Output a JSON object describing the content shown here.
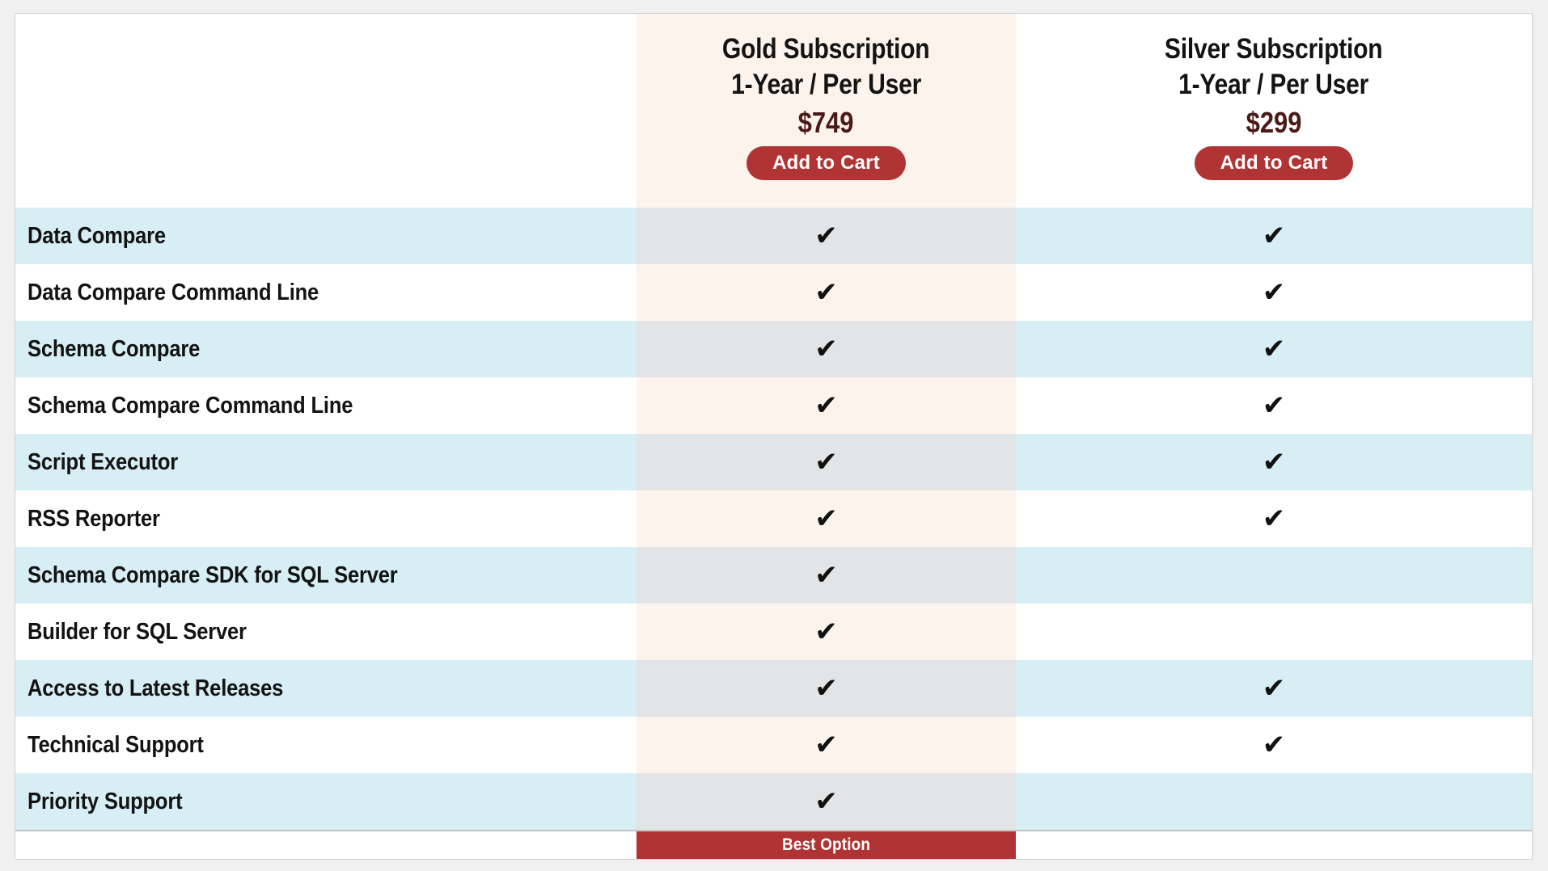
{
  "table": {
    "plans": [
      {
        "id": "gold",
        "name": "Gold Subscription",
        "term": "1-Year / Per User",
        "price": "$749",
        "cta_label": "Add to Cart",
        "badge": "Best Option",
        "accent_color": "#b03434",
        "price_color": "#4a1a16",
        "column_tint_odd": "#e3e4e5",
        "column_tint_even": "#fdf3ed"
      },
      {
        "id": "silver",
        "name": "Silver Subscription",
        "term": "1-Year / Per User",
        "price": "$299",
        "cta_label": "Add to Cart",
        "badge": "",
        "accent_color": "#b03434",
        "price_color": "#4a1a16",
        "column_tint_odd": "#d6eef4",
        "column_tint_even": "#ffffff"
      }
    ],
    "check_glyph": "✔",
    "stripe_color": "#d6eef4",
    "features": [
      {
        "label": "Data Compare",
        "gold": true,
        "silver": true
      },
      {
        "label": "Data Compare Command Line",
        "gold": true,
        "silver": true
      },
      {
        "label": "Schema Compare",
        "gold": true,
        "silver": true
      },
      {
        "label": "Schema Compare Command Line",
        "gold": true,
        "silver": true
      },
      {
        "label": "Script Executor",
        "gold": true,
        "silver": true
      },
      {
        "label": "RSS Reporter",
        "gold": true,
        "silver": true
      },
      {
        "label": "Schema Compare SDK for SQL Server",
        "gold": true,
        "silver": false
      },
      {
        "label": "Builder for SQL Server",
        "gold": true,
        "silver": false
      },
      {
        "label": "Access to Latest Releases",
        "gold": true,
        "silver": true
      },
      {
        "label": "Technical Support",
        "gold": true,
        "silver": true
      },
      {
        "label": "Priority Support",
        "gold": true,
        "silver": false
      }
    ]
  }
}
